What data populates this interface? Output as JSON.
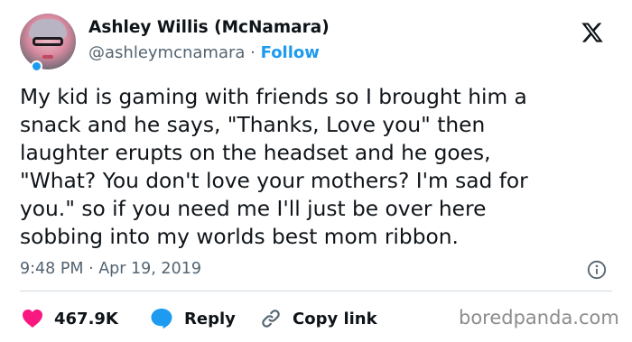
{
  "author": {
    "name": "Ashley Willis (McNamara)",
    "handle": "@ashleymcnamara",
    "separator": "·",
    "follow_label": "Follow"
  },
  "tweet": {
    "lines": [
      "My kid is gaming with friends so I brought him a",
      "snack and he says, \"Thanks, Love you\" then",
      "laughter erupts on the headset and he goes,",
      "\"What? You don't love your mothers? I'm sad for",
      "you.\" so if you need me I'll just be over here",
      "sobbing into my worlds best mom ribbon."
    ],
    "timestamp": "9:48 PM · Apr 19, 2019"
  },
  "actions": {
    "like_count": "467.9K",
    "reply_label": "Reply",
    "copy_label": "Copy link"
  },
  "watermark": "boredpanda.com",
  "colors": {
    "accent": "#1d9bf0",
    "like": "#f91880",
    "text": "#0f1419",
    "secondary": "#536471"
  },
  "icons": [
    "x-logo-icon",
    "info-icon",
    "heart-icon",
    "reply-bubble-icon",
    "link-icon"
  ]
}
